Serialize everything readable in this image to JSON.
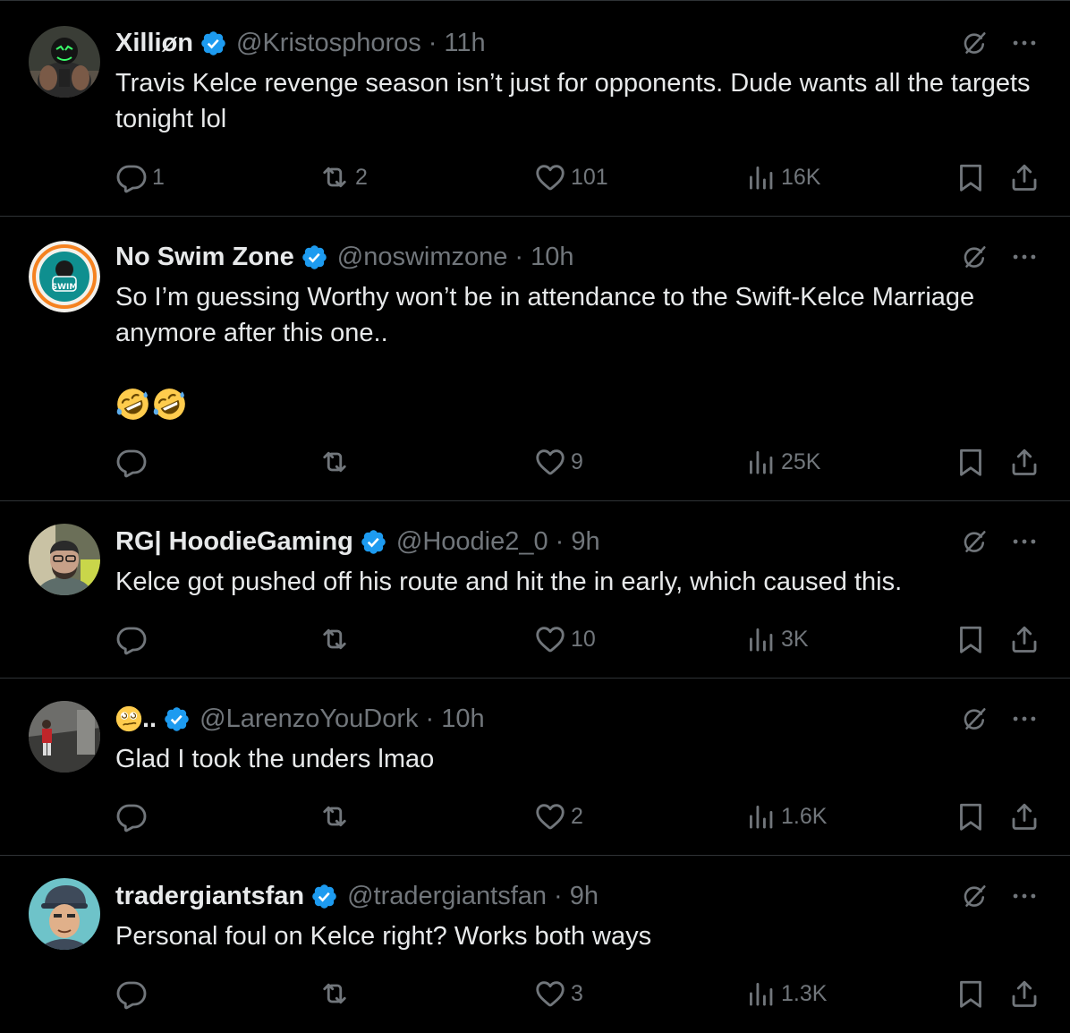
{
  "colors": {
    "background": "#000000",
    "text": "#e7e9ea",
    "muted": "#71767b",
    "divider": "#2f3336",
    "verified": "#1d9bf0"
  },
  "tweets": [
    {
      "name": "Xilliøn",
      "handle": "@Kristosphoros",
      "time": "11h",
      "text": "Travis Kelce revenge season isn’t just for opponents. Dude wants all the targets tonight lol",
      "replies": "1",
      "retweets": "2",
      "likes": "101",
      "views": "16K",
      "avatar_icon": "avatar-neon-mask"
    },
    {
      "name": "No Swim Zone",
      "handle": "@noswimzone",
      "time": "10h",
      "text": "So I’m guessing Worthy won’t be in attendance to the Swift-Kelce Marriage anymore after this one..",
      "emojis": [
        "rolling-on-floor-laughing-emoji",
        "rolling-on-floor-laughing-emoji"
      ],
      "replies": "",
      "retweets": "",
      "likes": "9",
      "views": "25K",
      "avatar_icon": "avatar-no-swim-logo",
      "avatar_text": "SWIM"
    },
    {
      "name": "RG| HoodieGaming",
      "handle": "@Hoodie2_0",
      "time": "9h",
      "text": "Kelce got pushed off his route and hit the in early, which caused this.",
      "replies": "",
      "retweets": "",
      "likes": "10",
      "views": "3K",
      "avatar_icon": "avatar-man-glasses"
    },
    {
      "name": "..",
      "name_emoji": "dizzy-face-emoji",
      "handle": "@LarenzoYouDork",
      "time": "10h",
      "text": "Glad I took the unders lmao",
      "replies": "",
      "retweets": "",
      "likes": "2",
      "views": "1.6K",
      "avatar_icon": "avatar-street-photo"
    },
    {
      "name": "tradergiantsfan",
      "handle": "@tradergiantsfan",
      "time": "9h",
      "text": "Personal foul on Kelce right? Works both ways",
      "replies": "",
      "retweets": "",
      "likes": "3",
      "views": "1.3K",
      "avatar_icon": "avatar-cartoon-man-cap"
    }
  ],
  "separator": "·"
}
